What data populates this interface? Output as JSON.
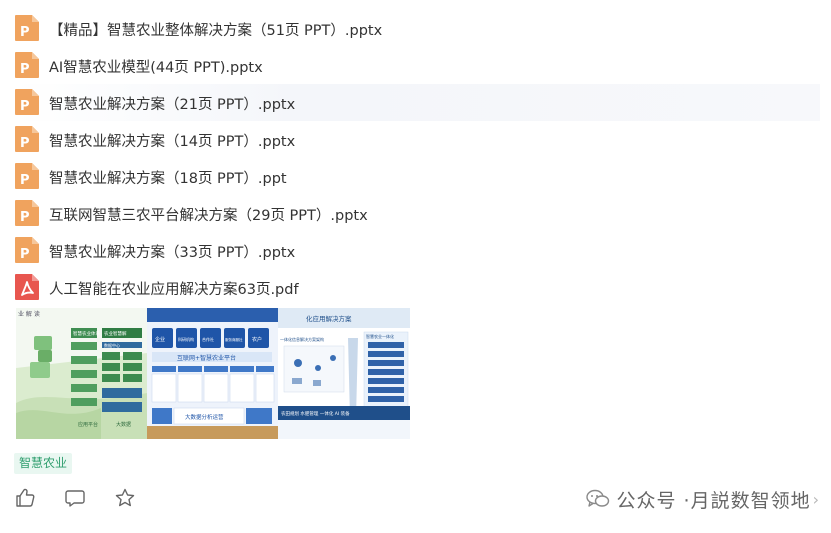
{
  "files": [
    {
      "name": "【精品】智慧农业整体解决方案（51页 PPT）.pptx",
      "type": "pptx",
      "icon": "ppt-file-icon"
    },
    {
      "name": "AI智慧农业模型(44页 PPT).pptx",
      "type": "pptx",
      "icon": "ppt-file-icon"
    },
    {
      "name": "智慧农业解决方案（21页 PPT）.pptx",
      "type": "pptx",
      "icon": "ppt-file-icon"
    },
    {
      "name": "智慧农业解决方案（14页 PPT）.pptx",
      "type": "pptx",
      "icon": "ppt-file-icon"
    },
    {
      "name": "智慧农业解决方案（18页 PPT）.ppt",
      "type": "ppt",
      "icon": "ppt-file-icon"
    },
    {
      "name": "互联网智慧三农平台解决方案（29页 PPT）.pptx",
      "type": "pptx",
      "icon": "ppt-file-icon"
    },
    {
      "name": "智慧农业解决方案（33页 PPT）.pptx",
      "type": "pptx",
      "icon": "ppt-file-icon"
    },
    {
      "name": "人工智能在农业应用解决方案63页.pdf",
      "type": "pdf",
      "icon": "pdf-file-icon"
    }
  ],
  "thumbnails": {
    "thumb1": {
      "header": "业 解 读",
      "boxes": [
        "智慧农业体系",
        "农业智慧解",
        "数据中心"
      ],
      "labels": [
        "应用平台",
        "大数据"
      ]
    },
    "thumb2": {
      "row1": [
        "企业",
        "科研机构",
        "合作社",
        "服务商服社",
        "农户"
      ],
      "banner": "互联网+智慧农业平台",
      "bottom": "大数据分析运营"
    },
    "thumb3": {
      "title": "化应用解决方案",
      "subtitle": "一体化信息解决方案架构",
      "right_title": "智慧农业一体化",
      "bottom": "农田规划 水肥管理 一体化 AI 装备"
    }
  },
  "tag": {
    "label": "智慧农业"
  },
  "actions": [
    {
      "name": "like",
      "icon": "thumbs-up-icon"
    },
    {
      "name": "comment",
      "icon": "comment-icon"
    },
    {
      "name": "favorite",
      "icon": "star-icon"
    }
  ],
  "account": {
    "prefix": "公众号 · ",
    "name": "月説数智领地",
    "arrow": "›"
  },
  "colors": {
    "ppt_icon": "#f0a35e",
    "pdf_icon": "#e8564f",
    "tag_bg": "#e9f7f1",
    "tag_text": "#2f9e6e",
    "text": "#333333",
    "muted": "#666666"
  }
}
